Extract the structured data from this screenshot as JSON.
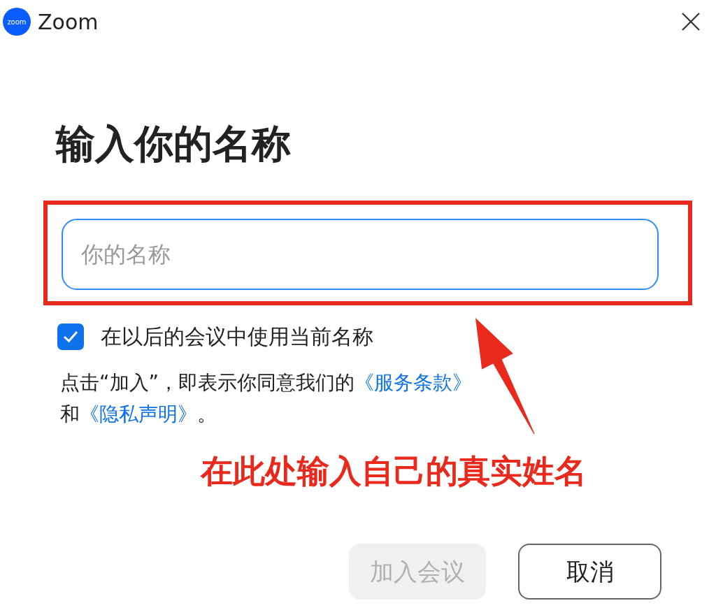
{
  "window": {
    "logo_text": "zoom",
    "title": "Zoom"
  },
  "heading": "输入你的名称",
  "name_field": {
    "placeholder": "你的名称",
    "highlighted": true
  },
  "remember_name": {
    "label": "在以后的会议中使用当前名称",
    "checked": true
  },
  "consent": [
    {
      "kind": "text",
      "text": "点击“加入”，即表示你同意我们的"
    },
    {
      "kind": "link",
      "text": "《服务条款》"
    },
    {
      "kind": "text",
      "text": "和"
    },
    {
      "kind": "link",
      "text": "《隐私声明》"
    },
    {
      "kind": "text",
      "text": "。"
    }
  ],
  "annotation": {
    "text": "在此处输入自己的真实姓名"
  },
  "buttons": [
    {
      "label": "加入会议",
      "kind": "primary",
      "disabled": true
    },
    {
      "label": "取消",
      "kind": "secondary",
      "disabled": false
    }
  ]
}
